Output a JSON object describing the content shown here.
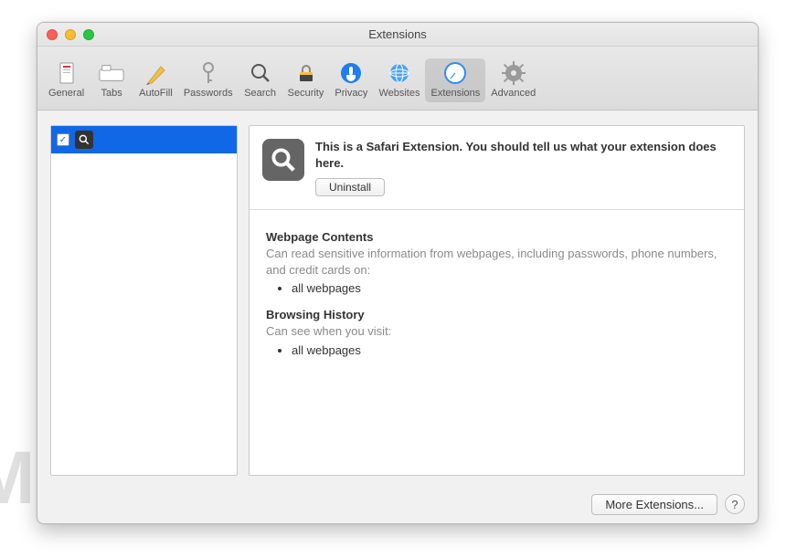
{
  "watermark": "MALWARETIPS",
  "window": {
    "title": "Extensions"
  },
  "toolbar": {
    "items": [
      {
        "label": "General"
      },
      {
        "label": "Tabs"
      },
      {
        "label": "AutoFill"
      },
      {
        "label": "Passwords"
      },
      {
        "label": "Search"
      },
      {
        "label": "Security"
      },
      {
        "label": "Privacy"
      },
      {
        "label": "Websites"
      },
      {
        "label": "Extensions"
      },
      {
        "label": "Advanced"
      }
    ]
  },
  "sidebar": {
    "items": [
      {
        "checked": true,
        "icon": "magnifier"
      }
    ]
  },
  "detail": {
    "description": "This is a Safari Extension. You should tell us what your extension does here.",
    "uninstall_label": "Uninstall",
    "sections": [
      {
        "heading": "Webpage Contents",
        "desc": "Can read sensitive information from webpages, including passwords, phone numbers, and credit cards on:",
        "bullets": [
          "all webpages"
        ]
      },
      {
        "heading": "Browsing History",
        "desc": "Can see when you visit:",
        "bullets": [
          "all webpages"
        ]
      }
    ]
  },
  "footer": {
    "more_label": "More Extensions...",
    "help_label": "?"
  }
}
